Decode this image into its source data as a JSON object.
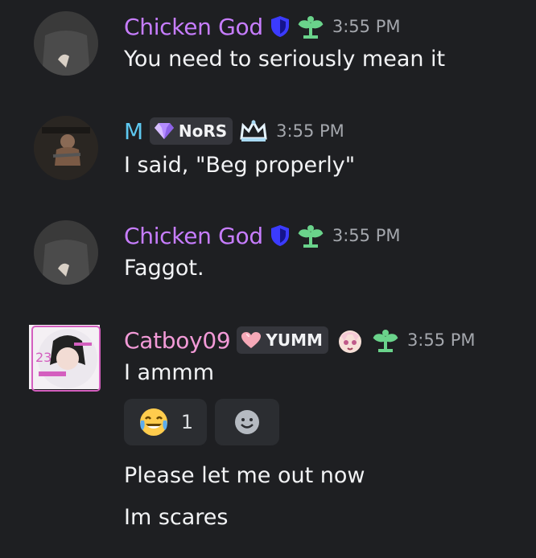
{
  "messages": [
    {
      "author": "Chicken God",
      "author_color": "#c77dff",
      "time": "3:55 PM",
      "badges": [
        "shield-icon",
        "leaf-icon"
      ],
      "lines": [
        "You need to seriously mean it"
      ]
    },
    {
      "author": "M",
      "author_color": "#5ec8f0",
      "tag": "NoRS",
      "tag_icon": "gem-icon",
      "time": "3:55 PM",
      "badges": [
        "crown-icon"
      ],
      "lines": [
        "I said, \"Beg properly\""
      ]
    },
    {
      "author": "Chicken God",
      "author_color": "#c77dff",
      "time": "3:55 PM",
      "badges": [
        "shield-icon",
        "leaf-icon"
      ],
      "lines": [
        "Faggot."
      ]
    },
    {
      "author": "Catboy09",
      "author_color": "#f29ad7",
      "tag": "YUMM",
      "tag_icon": "heart-icon",
      "time": "3:55 PM",
      "badges": [
        "anime-face-icon",
        "leaf-icon"
      ],
      "lines": [
        "I ammm"
      ],
      "reactions": [
        {
          "emoji": "laughing-tears-icon",
          "count": "1"
        }
      ],
      "followups": [
        "Please let me out now",
        "Im scares"
      ]
    }
  ]
}
